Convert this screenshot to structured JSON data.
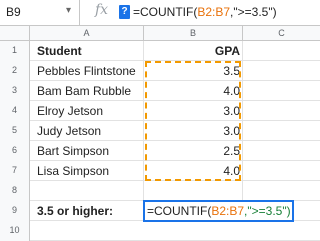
{
  "formula_bar": {
    "cell_ref": "B9",
    "dropdown_arrow": "▾",
    "fx_label": "fx",
    "help_label": "?",
    "formula_prefix": "=COUNTIF(",
    "formula_range": "B2:B7",
    "formula_suffix": ",\">=3.5\")"
  },
  "columns": [
    "A",
    "B",
    "C"
  ],
  "rows": [
    {
      "num": "1",
      "a": "Student",
      "b": "GPA"
    },
    {
      "num": "2",
      "a": "Pebbles Flintstone",
      "b": "3.5"
    },
    {
      "num": "3",
      "a": "Bam Bam Rubble",
      "b": "4.0"
    },
    {
      "num": "4",
      "a": "Elroy Jetson",
      "b": "3.0"
    },
    {
      "num": "5",
      "a": "Judy Jetson",
      "b": "3.0"
    },
    {
      "num": "6",
      "a": "Bart Simpson",
      "b": "2.5"
    },
    {
      "num": "7",
      "a": "Lisa Simpson",
      "b": "4.0"
    },
    {
      "num": "8",
      "a": "",
      "b": ""
    },
    {
      "num": "9",
      "a": "3.5 or higher:",
      "b": ""
    },
    {
      "num": "10",
      "a": "",
      "b": ""
    }
  ],
  "active_cell": {
    "prefix": "=COUNTIF(",
    "range": "B2:B7",
    "criteria": ",\">=3.5\")"
  },
  "colors": {
    "range_highlight": "#f29900",
    "active_border": "#1a73e8",
    "help_icon_bg": "#1a73e8"
  }
}
